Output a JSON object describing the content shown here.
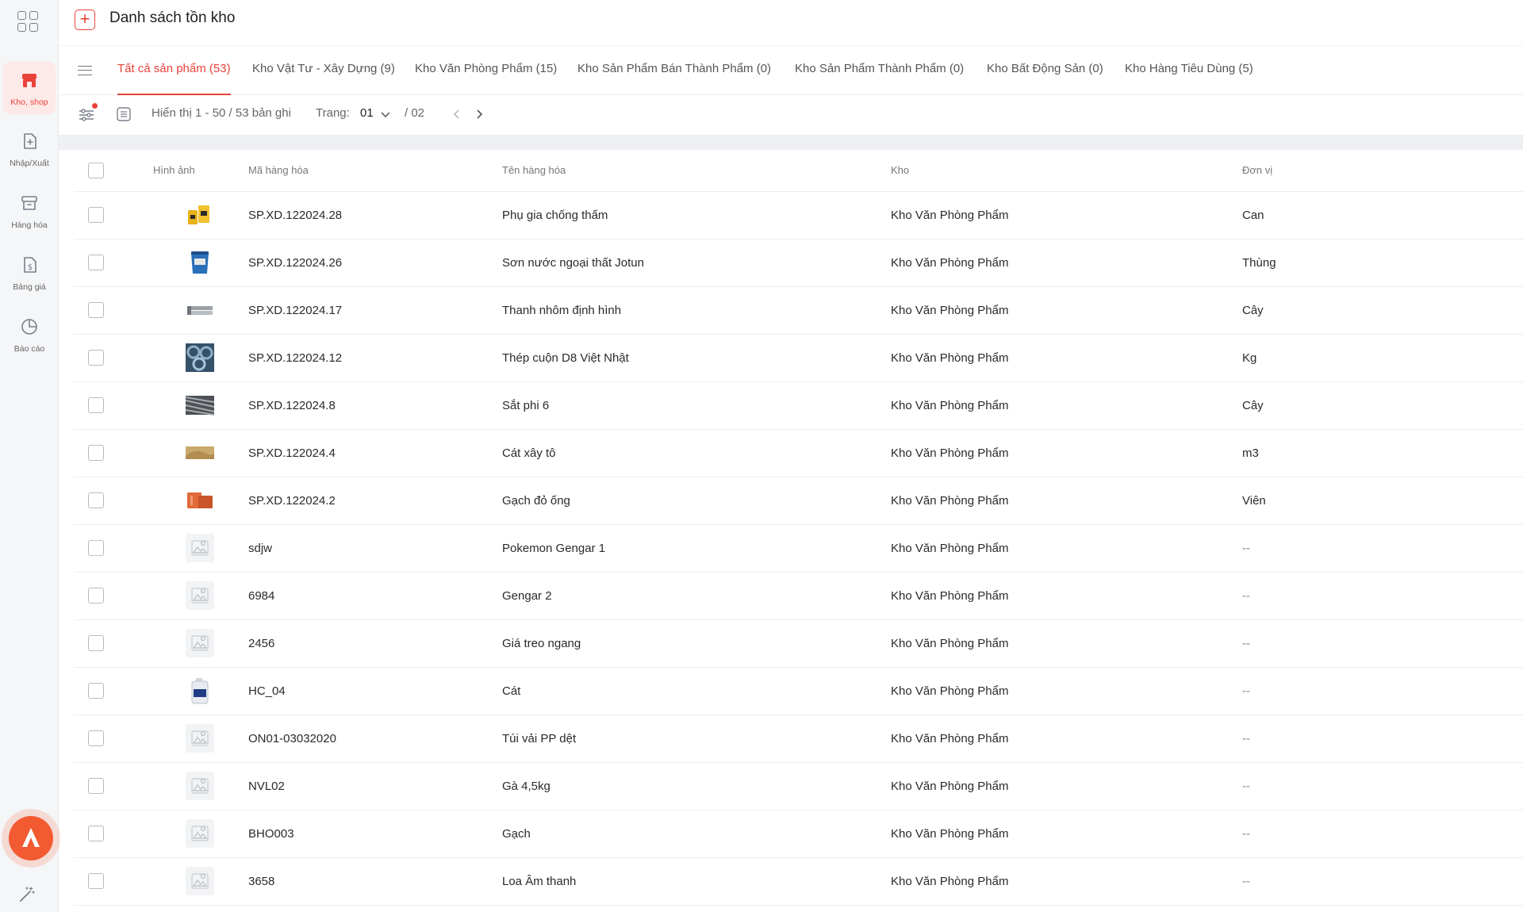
{
  "header": {
    "title": "Danh sách tồn kho"
  },
  "sidebar": {
    "items": [
      {
        "label": "Kho, shop"
      },
      {
        "label": "Nhập/Xuất"
      },
      {
        "label": "Hàng hóa"
      },
      {
        "label": "Bảng giá"
      },
      {
        "label": "Báo cáo"
      }
    ]
  },
  "tabs": [
    {
      "label": "Tất cả sản phẩm (53)"
    },
    {
      "label": "Kho Vật Tư - Xây Dựng (9)"
    },
    {
      "label": "Kho Văn Phòng Phẩm (15)"
    },
    {
      "label": "Kho Sản Phẩm Bán Thành Phẩm (0)"
    },
    {
      "label": "Kho Sản Phẩm Thành Phẩm (0)"
    },
    {
      "label": "Kho Bất Động Sản (0)"
    },
    {
      "label": "Kho Hàng Tiêu Dùng (5)"
    }
  ],
  "toolbar": {
    "display_info": "Hiển thị 1 - 50 / 53 bản ghi",
    "page_label": "Trang:",
    "page_value": "01",
    "page_total": "/ 02"
  },
  "table": {
    "columns": [
      "Hình ảnh",
      "Mã hàng hóa",
      "Tên hàng hóa",
      "Kho",
      "Đơn vị"
    ],
    "rows": [
      {
        "code": "SP.XD.122024.28",
        "name": "Phụ gia chống thấm",
        "kho": "Kho Văn Phòng Phẩm",
        "unit": "Can",
        "img": "yellow-cans"
      },
      {
        "code": "SP.XD.122024.26",
        "name": "Sơn nước ngoại thất Jotun",
        "kho": "Kho Văn Phòng Phẩm",
        "unit": "Thùng",
        "img": "blue-bucket"
      },
      {
        "code": "SP.XD.122024.17",
        "name": "Thanh nhôm định hình",
        "kho": "Kho Văn Phòng Phẩm",
        "unit": "Cây",
        "img": "aluminium-bars"
      },
      {
        "code": "SP.XD.122024.12",
        "name": "Thép cuộn D8 Việt Nhật",
        "kho": "Kho Văn Phòng Phẩm",
        "unit": "Kg",
        "img": "steel-coils"
      },
      {
        "code": "SP.XD.122024.8",
        "name": "Sắt phi 6",
        "kho": "Kho Văn Phòng Phẩm",
        "unit": "Cây",
        "img": "iron-rods"
      },
      {
        "code": "SP.XD.122024.4",
        "name": "Cát xây tô",
        "kho": "Kho Văn Phòng Phẩm",
        "unit": "m3",
        "img": "sand"
      },
      {
        "code": "SP.XD.122024.2",
        "name": "Gạch đỏ ống",
        "kho": "Kho Văn Phòng Phẩm",
        "unit": "Viên",
        "img": "red-bricks"
      },
      {
        "code": "sdjw",
        "name": "Pokemon Gengar 1",
        "kho": "Kho Văn Phòng Phẩm",
        "unit": "--",
        "img": "placeholder"
      },
      {
        "code": "6984",
        "name": "Gengar 2",
        "kho": "Kho Văn Phòng Phẩm",
        "unit": "--",
        "img": "placeholder"
      },
      {
        "code": "2456",
        "name": "Giá treo ngang",
        "kho": "Kho Văn Phòng Phẩm",
        "unit": "--",
        "img": "placeholder"
      },
      {
        "code": "HC_04",
        "name": "Cát",
        "kho": "Kho Văn Phòng Phẩm",
        "unit": "--",
        "img": "chemical-jug"
      },
      {
        "code": "ON01-03032020",
        "name": "Túi vải PP dệt",
        "kho": "Kho Văn Phòng Phẩm",
        "unit": "--",
        "img": "placeholder"
      },
      {
        "code": "NVL02",
        "name": "Gà 4,5kg",
        "kho": "Kho Văn Phòng Phẩm",
        "unit": "--",
        "img": "placeholder"
      },
      {
        "code": "BHO003",
        "name": "Gạch",
        "kho": "Kho Văn Phòng Phẩm",
        "unit": "--",
        "img": "placeholder"
      },
      {
        "code": "3658",
        "name": "Loa Âm thanh",
        "kho": "Kho Văn Phòng Phẩm",
        "unit": "--",
        "img": "placeholder"
      }
    ]
  },
  "colors": {
    "accent": "#e8423a",
    "fab": "#f25a31"
  }
}
